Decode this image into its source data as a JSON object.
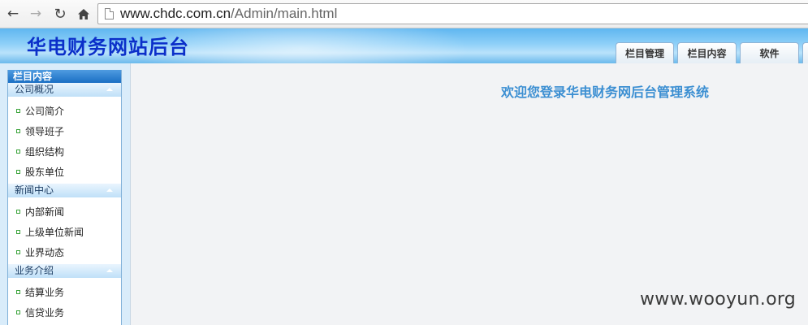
{
  "browser": {
    "url_host": "www.chdc.com.cn",
    "url_path": "/Admin/main.html",
    "icons": [
      "back-arrow-icon",
      "forward-arrow-icon",
      "reload-icon",
      "home-icon",
      "page-icon"
    ]
  },
  "header": {
    "site_title": "华电财务网站后台",
    "tabs": [
      {
        "label": "栏目管理"
      },
      {
        "label": "栏目内容"
      },
      {
        "label": "软件"
      },
      {
        "label": ""
      }
    ]
  },
  "sidebar": {
    "title": "栏目内容",
    "groups": [
      {
        "label": "公司概况",
        "items": [
          "公司简介",
          "领导班子",
          "组织结构",
          "股东单位"
        ]
      },
      {
        "label": "新闻中心",
        "items": [
          "内部新闻",
          "上级单位新闻",
          "业界动态"
        ]
      },
      {
        "label": "业务介绍",
        "items": [
          "结算业务",
          "信贷业务"
        ]
      }
    ]
  },
  "main": {
    "welcome_text": "欢迎您登录华电财务网后台管理系统"
  },
  "watermark": "www.wooyun.org",
  "colors": {
    "title": "#0b2fc9",
    "welcome": "#3c8fd2",
    "header_bg": "#6bb9ec",
    "sidebar_title_bg": "#1a6fc4"
  }
}
